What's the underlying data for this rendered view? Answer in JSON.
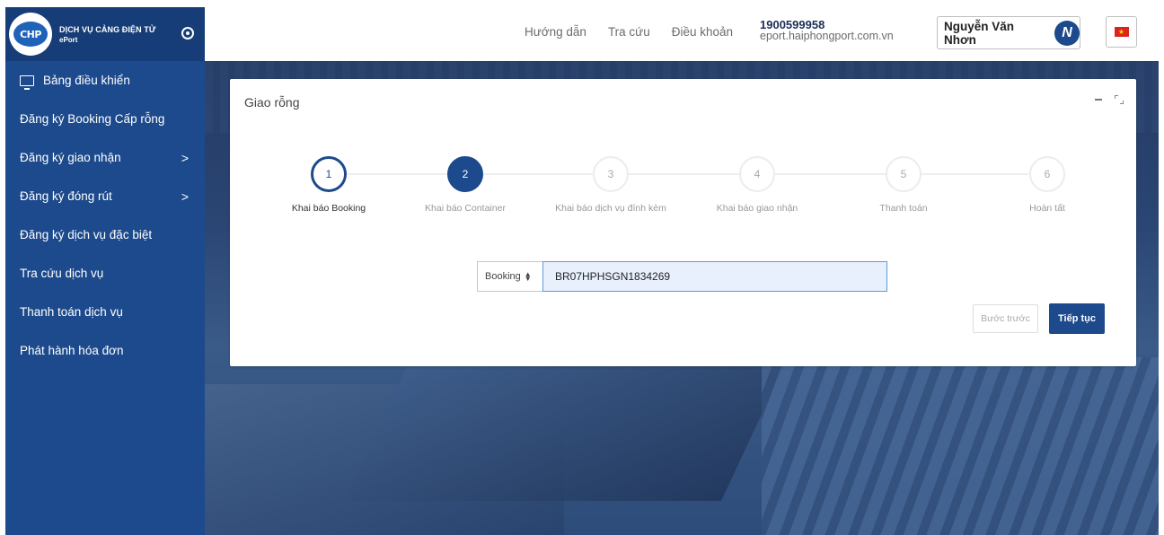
{
  "brand": {
    "logo_text": "CHP",
    "title": "DỊCH VỤ CẢNG ĐIỆN TỬ",
    "subtitle": "ePort"
  },
  "sidebar": {
    "items": [
      {
        "label": "Bảng điều khiển",
        "icon": "monitor-icon",
        "has_submenu": false
      },
      {
        "label": "Đăng ký Booking Cấp rỗng",
        "has_submenu": false
      },
      {
        "label": "Đăng ký giao nhận",
        "has_submenu": true
      },
      {
        "label": "Đăng ký đóng rút",
        "has_submenu": true
      },
      {
        "label": "Đăng ký dịch vụ đặc biệt",
        "has_submenu": false
      },
      {
        "label": "Tra cứu dịch vụ",
        "has_submenu": false
      },
      {
        "label": "Thanh toán dịch vụ",
        "has_submenu": false
      },
      {
        "label": "Phát hành hóa đơn",
        "has_submenu": false
      }
    ],
    "chevron": ">"
  },
  "header": {
    "links": [
      "Hướng dẫn",
      "Tra cứu",
      "Điều khoản"
    ],
    "hotline": "1900599958",
    "website": "eport.haiphongport.com.vn",
    "user_name": "Nguyễn Văn Nhơn",
    "avatar_letter": "N",
    "flag_star": "★"
  },
  "card": {
    "title": "Giao rỗng",
    "steps": [
      {
        "number": "1",
        "label": "Khai báo Booking",
        "state": "current"
      },
      {
        "number": "2",
        "label": "Khai báo Container",
        "state": "done"
      },
      {
        "number": "3",
        "label": "Khai báo dịch vụ đính kèm",
        "state": "pending"
      },
      {
        "number": "4",
        "label": "Khai báo giao nhận",
        "state": "pending"
      },
      {
        "number": "5",
        "label": "Thanh toán",
        "state": "pending"
      },
      {
        "number": "6",
        "label": "Hoàn tất",
        "state": "pending"
      }
    ],
    "search": {
      "select_value": "Booking",
      "input_value": "BR07HPHSGN1834269"
    },
    "buttons": {
      "prev": "Bước trước",
      "next": "Tiếp tục"
    }
  },
  "colors": {
    "primary": "#1c4a8c",
    "sidebar_bg": "#1c4a8c",
    "input_bg": "#e8f0fe"
  }
}
